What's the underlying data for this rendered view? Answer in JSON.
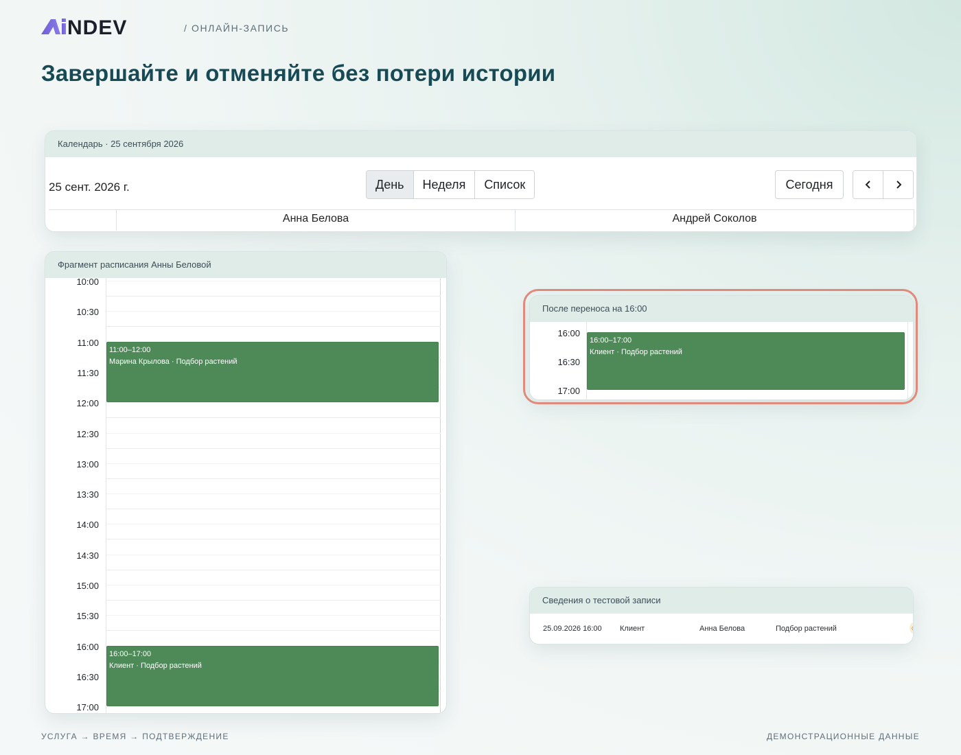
{
  "header": {
    "logo_text": "AiNDEV",
    "crumb": "/ ОНЛАЙН-ЗАПИСЬ",
    "title": "Завершайте и отменяйте без потери истории"
  },
  "calendar": {
    "card_title": "Календарь · 25 сентября 2026",
    "date_label": "25 сент. 2026 г.",
    "views": [
      "День",
      "Неделя",
      "Список"
    ],
    "active_view": "День",
    "today_label": "Сегодня",
    "resources": [
      "Анна Белова",
      "Андрей Соколов"
    ]
  },
  "schedule": {
    "card_title": "Фрагмент расписания Анны Беловой",
    "times": [
      "10:00",
      "10:30",
      "11:00",
      "11:30",
      "12:00",
      "12:30",
      "13:00",
      "13:30",
      "14:00",
      "14:30",
      "15:00",
      "15:30",
      "16:00",
      "16:30",
      "17:00"
    ],
    "events": [
      {
        "time": "11:00–12:00",
        "title": "Марина Крылова · Подбор растений",
        "start": "11:00",
        "end": "12:00"
      },
      {
        "time": "16:00–17:00",
        "title": "Клиент · Подбор растений",
        "start": "16:00",
        "end": "17:00"
      }
    ]
  },
  "after": {
    "card_title": "После переноса на 16:00",
    "times": [
      "16:00",
      "16:30",
      "17:00"
    ],
    "event": {
      "time": "16:00–17:00",
      "title": "Клиент · Подбор растений"
    }
  },
  "details": {
    "card_title": "Сведения о тестовой записи",
    "row": {
      "datetime": "25.09.2026 16:00",
      "client": "Клиент",
      "master": "Анна Белова",
      "service": "Подбор растений",
      "badge": "с"
    }
  },
  "footer": {
    "left": "УСЛУГА → ВРЕМЯ → ПОДТВЕРЖДЕНИЕ",
    "right": "ДЕМОНСТРАЦИОННЫЕ ДАННЫЕ"
  },
  "colors": {
    "title": "#184a55",
    "event_green": "#4e8a58",
    "card_header": "#dfece8",
    "highlight_ring": "#df8a7a"
  }
}
